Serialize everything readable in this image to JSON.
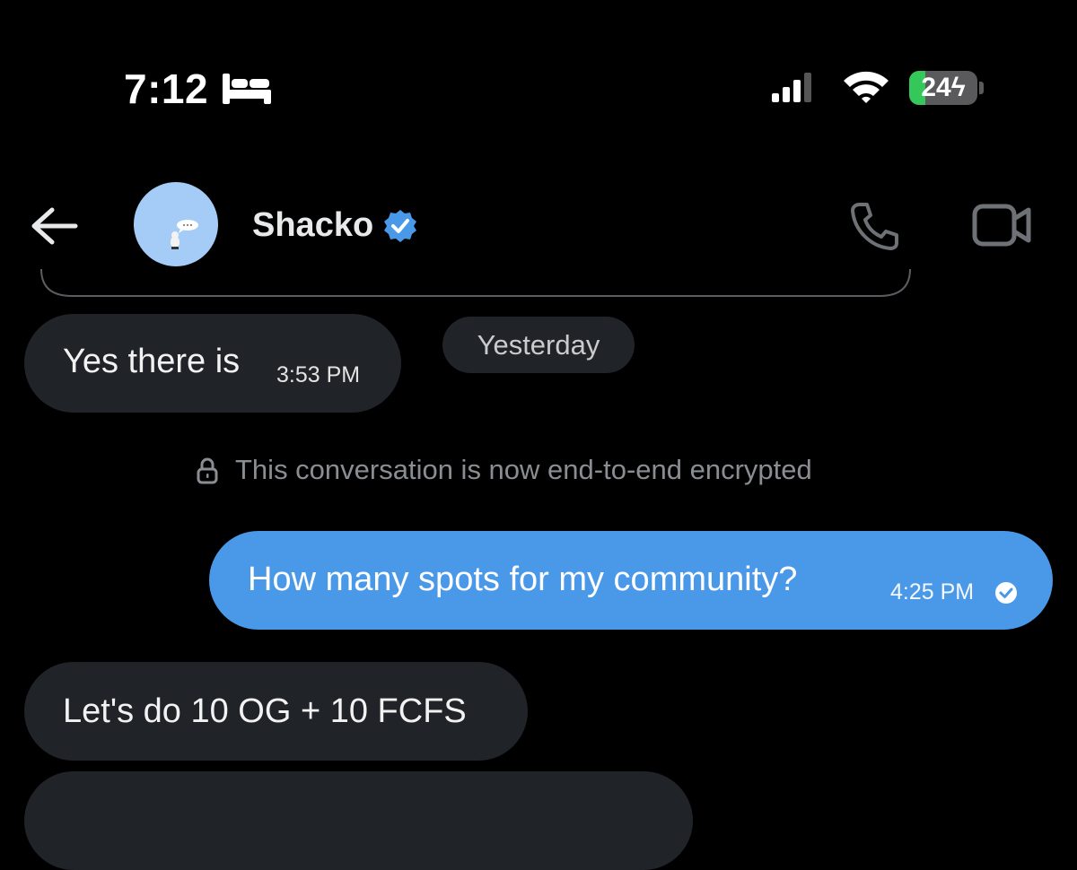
{
  "status_bar": {
    "time": "7:12",
    "focus_icon": "bed-icon",
    "battery_level": 24,
    "battery_label": "24",
    "battery_charging": true
  },
  "header": {
    "contact_name": "Shacko",
    "verified": true,
    "icons": [
      "back-arrow-icon",
      "phone-icon",
      "video-camera-icon"
    ]
  },
  "date_separator": "Yesterday",
  "encryption_notice": "This conversation is now end-to-end encrypted",
  "messages": [
    {
      "direction": "incoming",
      "text": "Yes there is",
      "time": "3:53 PM"
    },
    {
      "direction": "outgoing",
      "text": "How many spots for my community?",
      "time": "4:25 PM",
      "status": "read"
    },
    {
      "direction": "incoming",
      "text": "Let's do 10 OG + 10 FCFS"
    }
  ],
  "colors": {
    "background": "#000000",
    "incoming_bubble": "#202327",
    "outgoing_bubble": "#4a99e9",
    "verified_badge": "#4a99e9",
    "avatar_bg": "#a5ccf6",
    "battery_charge": "#34c759"
  }
}
